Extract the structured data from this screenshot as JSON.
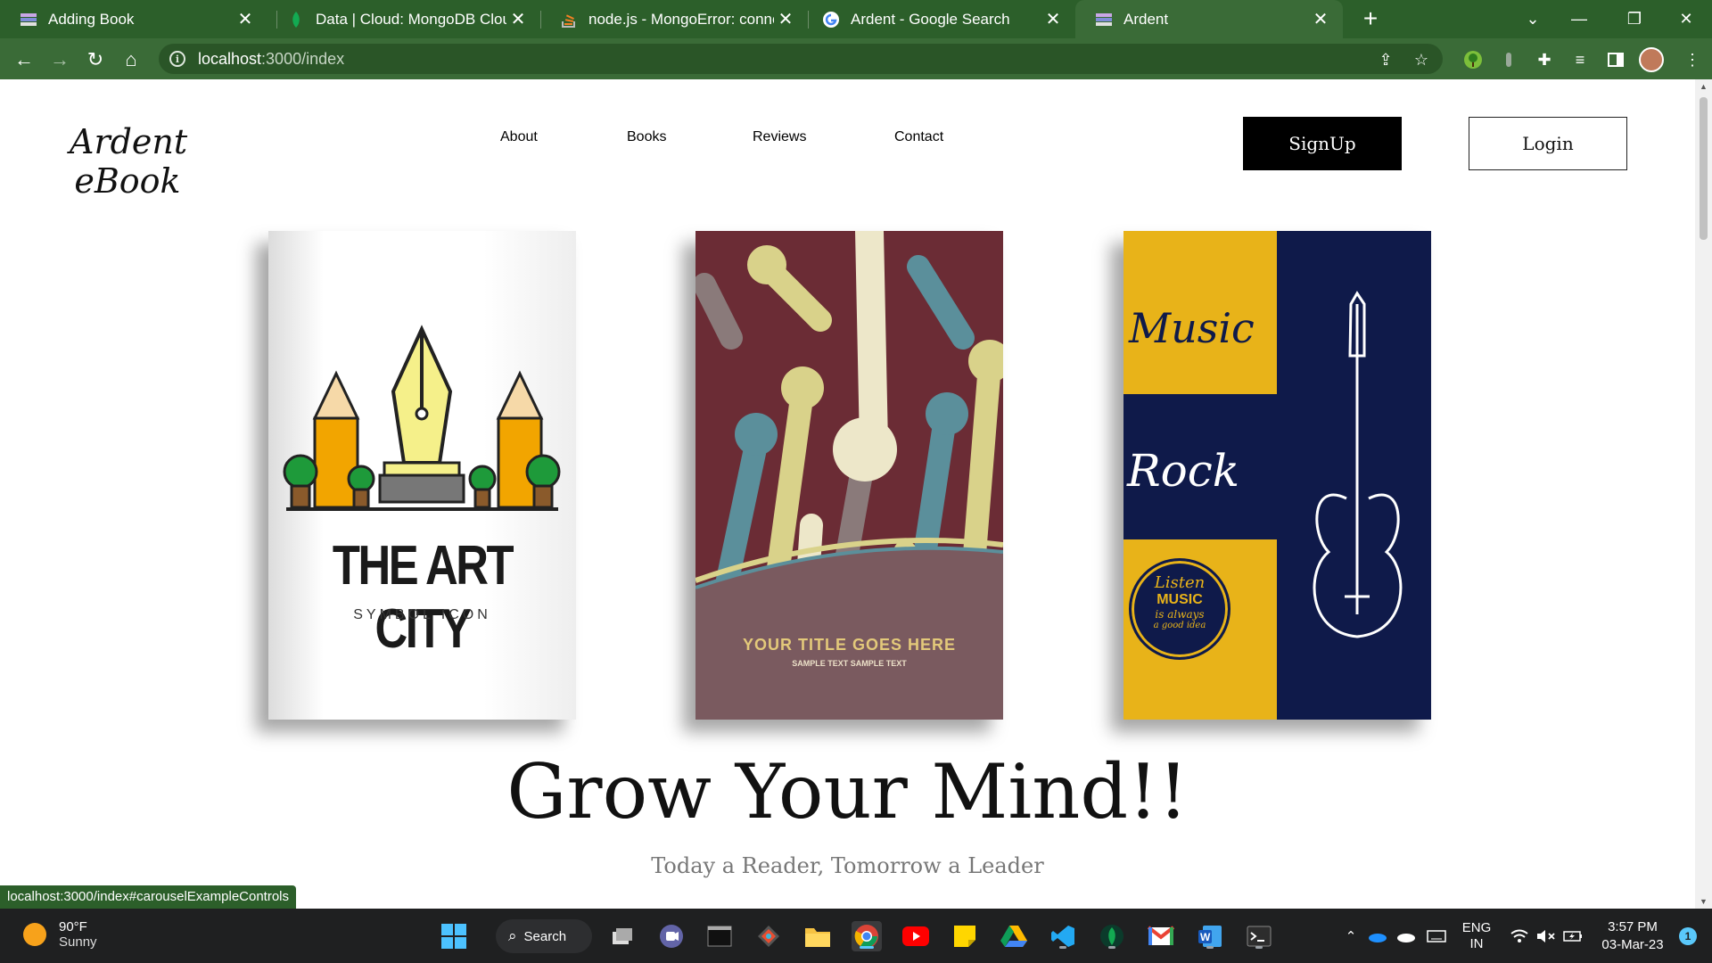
{
  "browser": {
    "tabs": [
      {
        "title": "Adding Book",
        "icon": "book-stack-icon"
      },
      {
        "title": "Data | Cloud: MongoDB Cloud",
        "icon": "mongodb-leaf-icon"
      },
      {
        "title": "node.js - MongoError: connect EC",
        "icon": "stackoverflow-icon"
      },
      {
        "title": "Ardent - Google Search",
        "icon": "google-icon"
      },
      {
        "title": "Ardent",
        "icon": "book-stack-icon",
        "active": true
      }
    ],
    "url_host": "localhost",
    "url_path": ":3000/index",
    "status_url": "localhost:3000/index#carouselExampleControls"
  },
  "site": {
    "logo_line1": "Ardent",
    "logo_line2": "eBook",
    "nav": [
      "About",
      "Books",
      "Reviews",
      "Contact"
    ],
    "signup_label": "SignUp",
    "login_label": "Login",
    "headline": "Grow Your Mind!!",
    "subline": "Today a Reader, Tomorrow a Leader",
    "books": [
      {
        "title": "THE ART CITY",
        "subtitle": "SYMBOL ICON"
      },
      {
        "title": "YOUR TITLE GOES HERE",
        "subtitle": "SAMPLE TEXT SAMPLE TEXT"
      },
      {
        "words": [
          "Music",
          "Rock",
          "Listen",
          "MUSIC",
          "is always",
          "a good idea"
        ]
      }
    ]
  },
  "taskbar": {
    "weather_temp": "90°F",
    "weather_desc": "Sunny",
    "search_label": "Search",
    "lang_1": "ENG",
    "lang_2": "IN",
    "time": "3:57 PM",
    "date": "03-Mar-23",
    "notification_count": "1"
  },
  "colors": {
    "chrome_dark": "#2c5f2a",
    "chrome_active": "#3a6b37",
    "signup_bg": "#000000",
    "music_yellow": "#e8b319",
    "music_navy": "#0f1a4a",
    "hands_bg": "#6b2c35"
  }
}
